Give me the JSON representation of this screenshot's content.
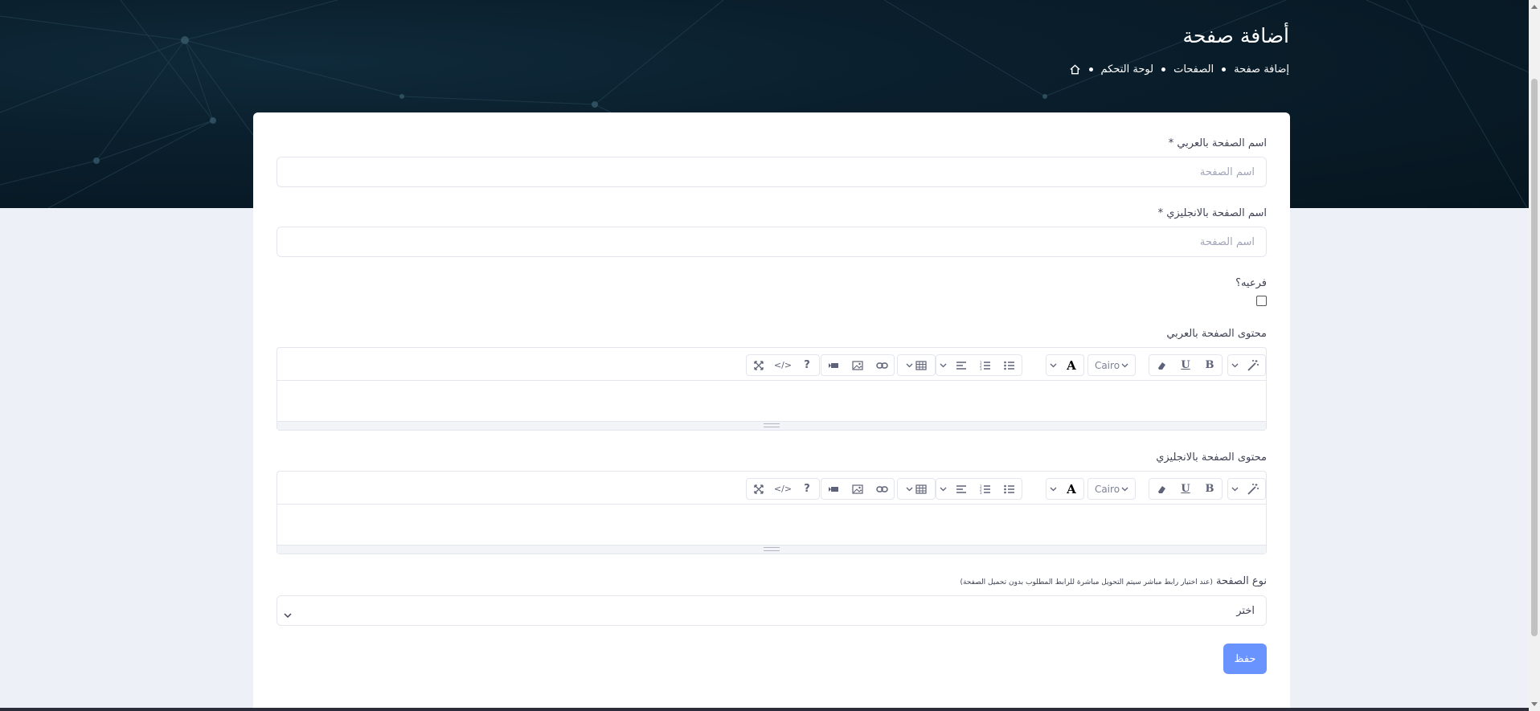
{
  "header": {
    "title": "أضافة صفحة",
    "breadcrumb": [
      "لوحة التحكم",
      "الصفحات",
      "إضافة صفحة"
    ],
    "home_icon": "home-icon"
  },
  "form": {
    "name_ar": {
      "label": "اسم الصفحة بالعربي",
      "required_mark": "*",
      "placeholder": "اسم الصفحة",
      "value": ""
    },
    "name_en": {
      "label": "اسم الصفحة بالانجليزي",
      "required_mark": "*",
      "placeholder": "اسم الصفحة",
      "value": ""
    },
    "is_sub": {
      "label": "فرعيه؟",
      "checked": false
    },
    "content_ar": {
      "label": "محتوى الصفحة بالعربي"
    },
    "content_en": {
      "label": "محتوى الصفحة بالانجليزي"
    },
    "page_type": {
      "label": "نوع الصفحة",
      "hint": "(عند اختيار رابط مباشر سيتم التحويل مباشرة للرابط المطلوب بدون تحميل الصفحة)",
      "selected": "اختر"
    },
    "save_label": "حفظ"
  },
  "editor_toolbar": {
    "font_name": "Cairo",
    "buttons": [
      "magic-icon",
      "bold-icon",
      "underline-icon",
      "eraser-icon",
      "font-select",
      "text-color-icon",
      "unordered-list-icon",
      "ordered-list-icon",
      "align-icon",
      "table-icon",
      "link-icon",
      "picture-icon",
      "video-icon",
      "fullscreen-icon",
      "code-view-icon",
      "help-icon"
    ],
    "bold_glyph": "B",
    "underline_glyph": "U",
    "color_glyph": "A",
    "help_glyph": "?",
    "code_glyph": "</>"
  },
  "colors": {
    "primary_button": "#6993ff",
    "hero_bg": "#0a1e2c",
    "page_bg": "#eef0f7"
  }
}
